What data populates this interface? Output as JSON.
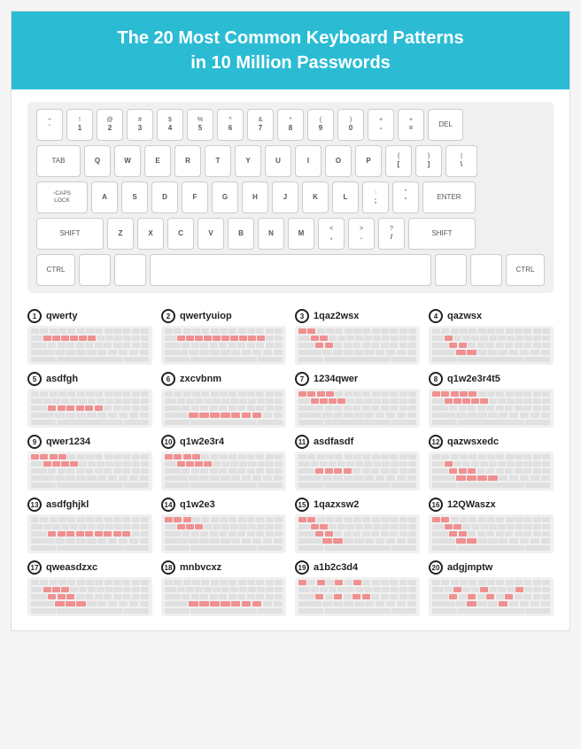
{
  "header": {
    "title": "The 20 Most Common Keyboard Patterns",
    "subtitle": "in 10 Million Passwords"
  },
  "keyboard": {
    "rows": [
      [
        "` ~",
        "! 1",
        "@ 2",
        "# 3",
        "$ 4",
        "% 5",
        "^ 6",
        "& 7",
        "* 8",
        "( 9",
        ") 0",
        "- =",
        "+ =",
        "DEL"
      ],
      [
        "TAB",
        "Q",
        "W",
        "E",
        "R",
        "T",
        "Y",
        "U",
        "I",
        "O",
        "P",
        "{ [",
        "} ]",
        "| \\"
      ],
      [
        "CAPS LOCK",
        "A",
        "S",
        "D",
        "F",
        "G",
        "H",
        "J",
        "K",
        "L",
        ": ;",
        "\" '",
        "ENTER"
      ],
      [
        "SHIFT",
        "Z",
        "X",
        "C",
        "V",
        "B",
        "N",
        "M",
        "< ,",
        "> .",
        "? /",
        "SHIFT"
      ],
      [
        "CTRL",
        "",
        "",
        "",
        "",
        "CTRL"
      ]
    ]
  },
  "patterns": [
    {
      "num": 1,
      "name": "qwerty"
    },
    {
      "num": 2,
      "name": "qwertyuiop"
    },
    {
      "num": 3,
      "name": "1qaz2wsx"
    },
    {
      "num": 4,
      "name": "qazwsx"
    },
    {
      "num": 5,
      "name": "asdfgh"
    },
    {
      "num": 6,
      "name": "zxcvbnm"
    },
    {
      "num": 7,
      "name": "1234qwer"
    },
    {
      "num": 8,
      "name": "q1w2e3r4t5"
    },
    {
      "num": 9,
      "name": "qwer1234"
    },
    {
      "num": 10,
      "name": "q1w2e3r4"
    },
    {
      "num": 11,
      "name": "asdfasdf"
    },
    {
      "num": 12,
      "name": "qazwsxedc"
    },
    {
      "num": 13,
      "name": "asdfghjkl"
    },
    {
      "num": 14,
      "name": "q1w2e3"
    },
    {
      "num": 15,
      "name": "1qazxsw2"
    },
    {
      "num": 16,
      "name": "12QWaszx"
    },
    {
      "num": 17,
      "name": "qweasdzxc"
    },
    {
      "num": 18,
      "name": "mnbvcxz"
    },
    {
      "num": 19,
      "name": "a1b2c3d4"
    },
    {
      "num": 20,
      "name": "adgjmptw"
    }
  ]
}
